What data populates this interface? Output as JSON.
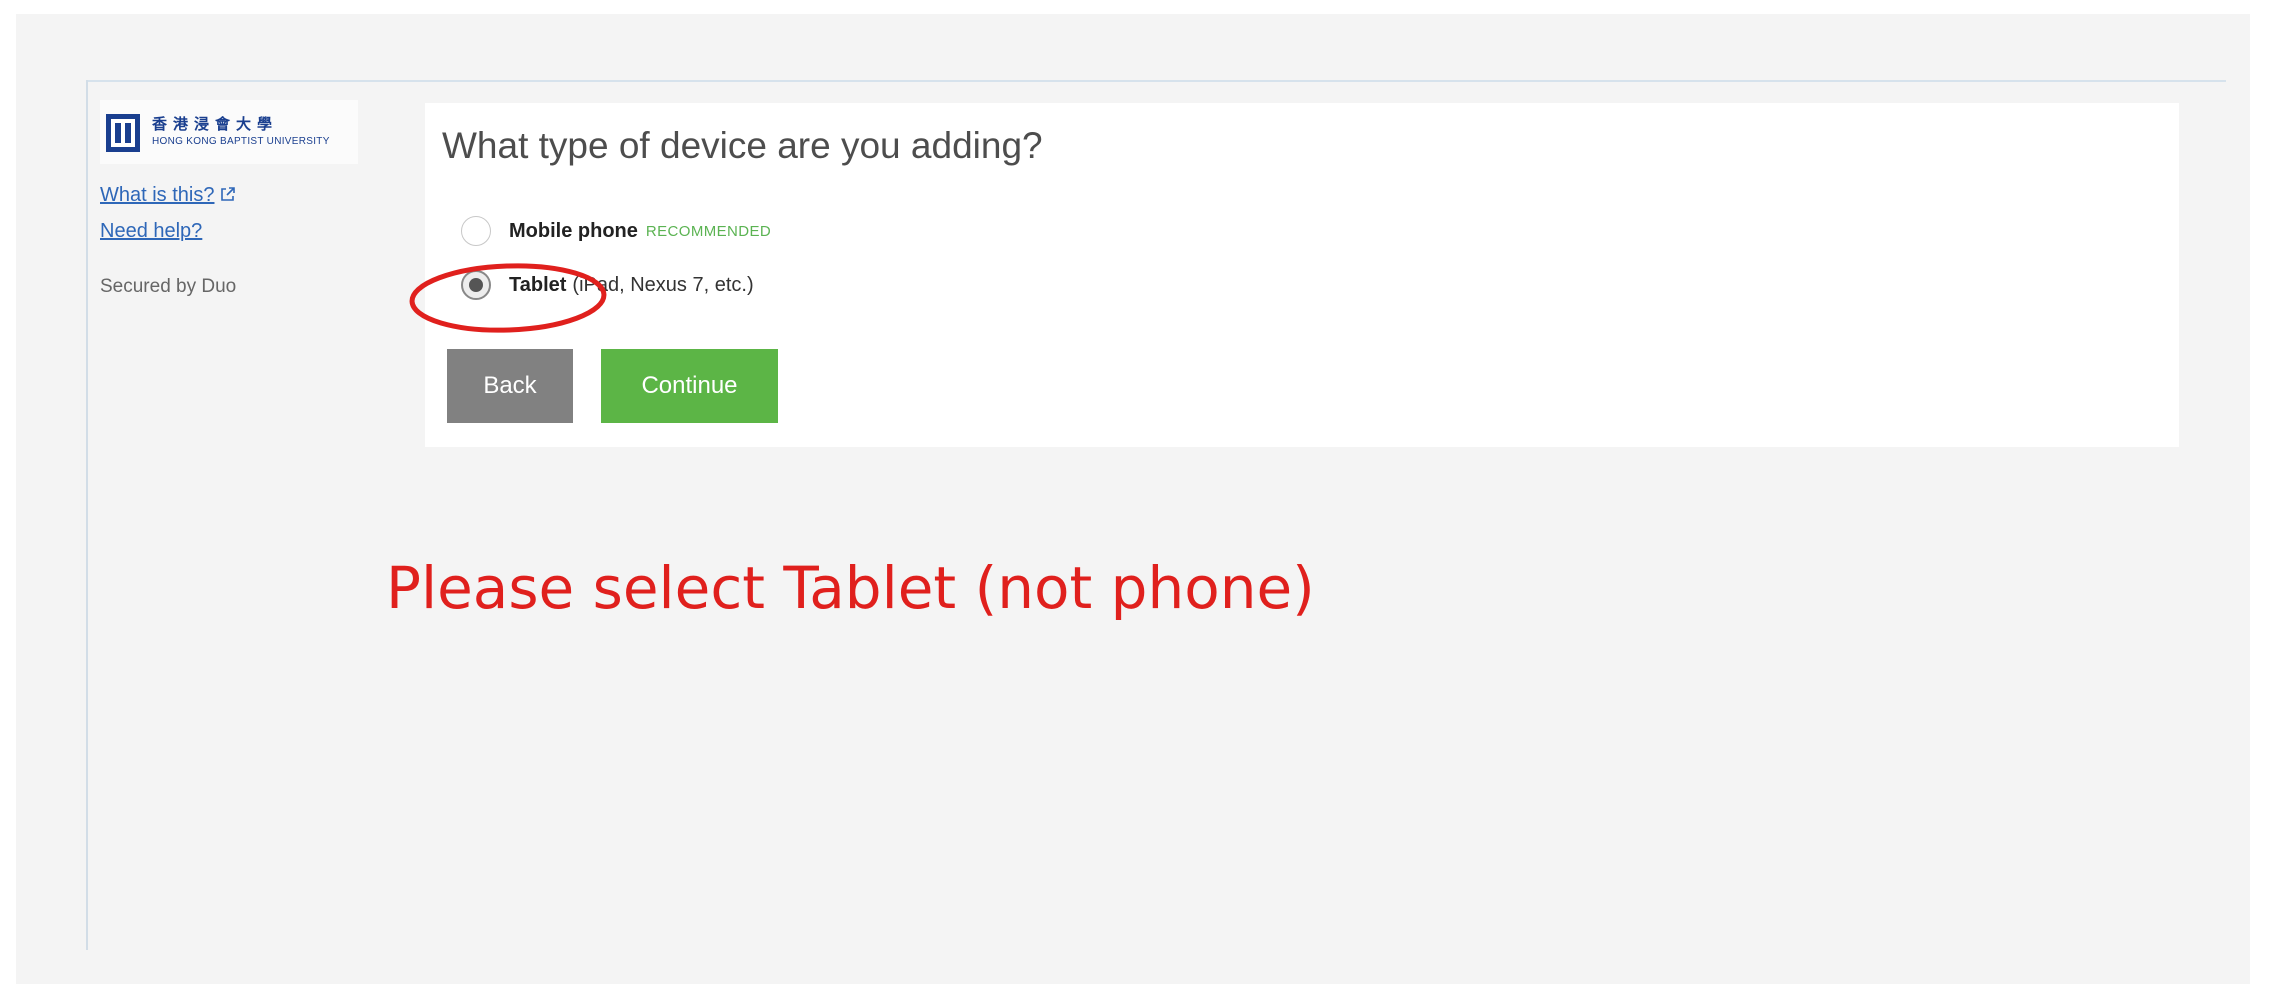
{
  "sidebar": {
    "logo": {
      "name_cn": "香港浸會大學",
      "name_en": "HONG KONG BAPTIST UNIVERSITY"
    },
    "what_is_this_label": "What is this?",
    "need_help_label": "Need help?",
    "secured_by": "Secured by Duo"
  },
  "main": {
    "question": "What type of device are you adding?",
    "options": [
      {
        "label": "Mobile phone",
        "badge": "RECOMMENDED",
        "detail": "",
        "selected": false
      },
      {
        "label": "Tablet",
        "badge": "",
        "detail": "(iPad, Nexus 7, etc.)",
        "selected": true
      }
    ],
    "back_label": "Back",
    "continue_label": "Continue"
  },
  "annotation": {
    "instruction": "Please select Tablet (not phone)"
  },
  "colors": {
    "continue_button": "#5cb546",
    "back_button": "#818181",
    "recommended_badge": "#5bb352",
    "annotation": "#e0201d",
    "link": "#2e67b8"
  },
  "icons": [
    "hkbu-logo-icon",
    "external-link-icon"
  ]
}
